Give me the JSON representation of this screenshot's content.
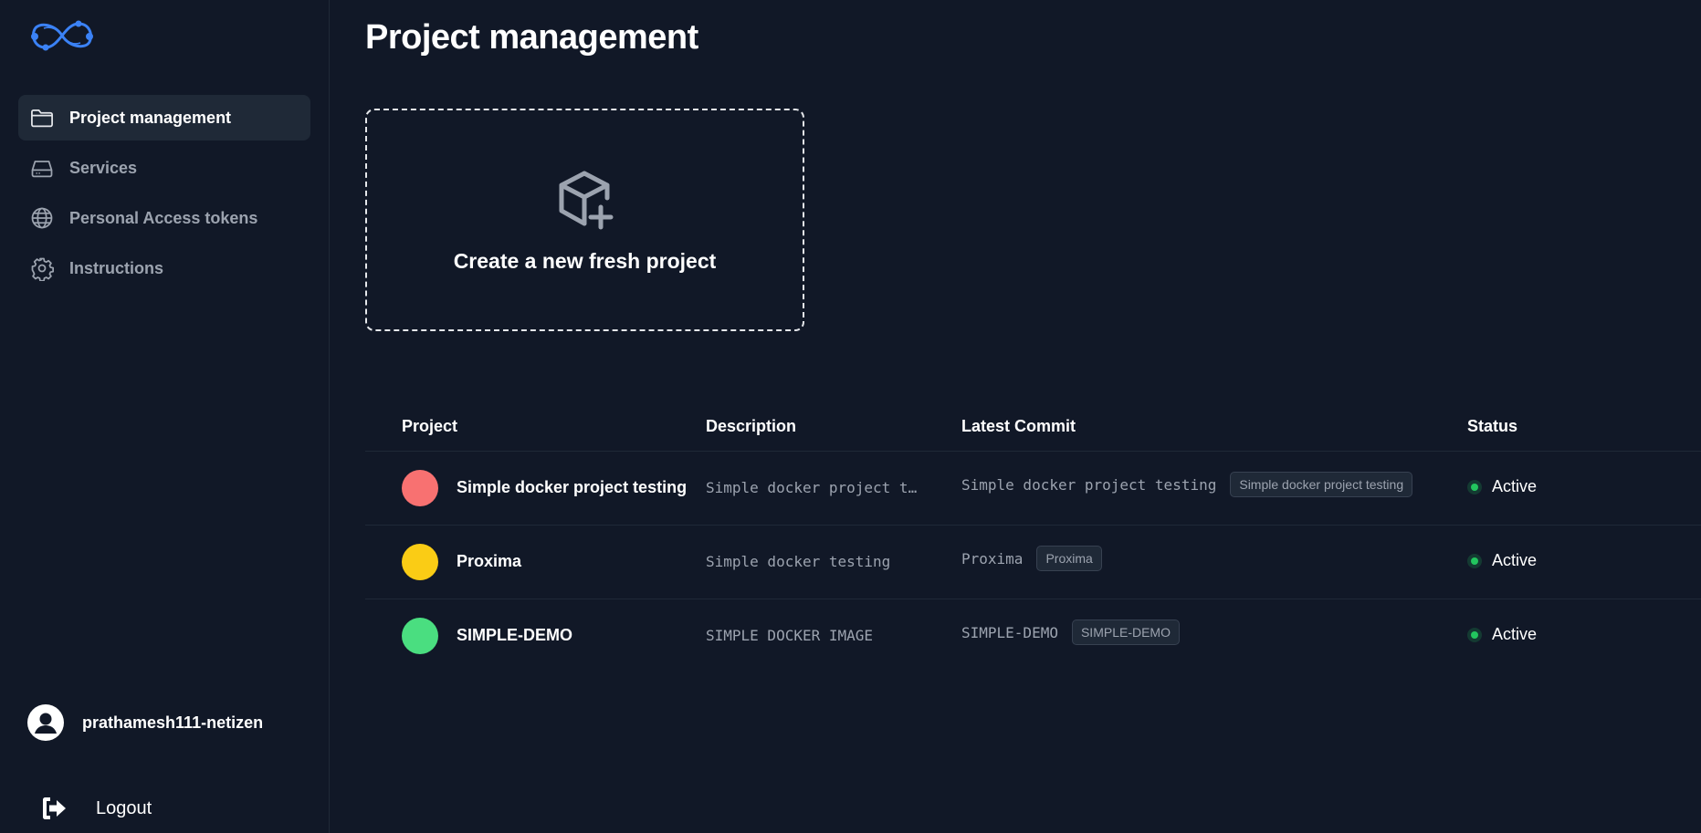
{
  "sidebar": {
    "logo": "infinity-logo",
    "items": [
      {
        "label": "Project management",
        "icon": "folder-icon",
        "active": true
      },
      {
        "label": "Services",
        "icon": "server-icon",
        "active": false
      },
      {
        "label": "Personal Access tokens",
        "icon": "globe-icon",
        "active": false
      },
      {
        "label": "Instructions",
        "icon": "gear-icon",
        "active": false
      }
    ],
    "user": {
      "name": "prathamesh111-netizen",
      "icon": "user-avatar-icon"
    },
    "logout_label": "Logout"
  },
  "main": {
    "title": "Project management",
    "create_card": {
      "label": "Create a new fresh project",
      "icon": "cube-plus-icon"
    },
    "table": {
      "headers": {
        "project": "Project",
        "description": "Description",
        "commit": "Latest Commit",
        "status": "Status"
      },
      "rows": [
        {
          "name": "Simple docker project testing",
          "color": "#f87171",
          "description": "Simple docker project testing",
          "commit": "Simple docker project testing",
          "badge": "Simple docker project testing",
          "status": "Active"
        },
        {
          "name": "Proxima",
          "color": "#facc15",
          "description": "Simple docker testing",
          "commit": "Proxima",
          "badge": "Proxima",
          "status": "Active"
        },
        {
          "name": "SIMPLE-DEMO",
          "color": "#4ade80",
          "description": "SIMPLE DOCKER IMAGE",
          "commit": "SIMPLE-DEMO",
          "badge": "SIMPLE-DEMO",
          "status": "Active"
        }
      ]
    }
  },
  "colors": {
    "background": "#111827",
    "active_nav": "#1f2937",
    "status_active": "#22c55e",
    "logo": "#3b82f6"
  }
}
